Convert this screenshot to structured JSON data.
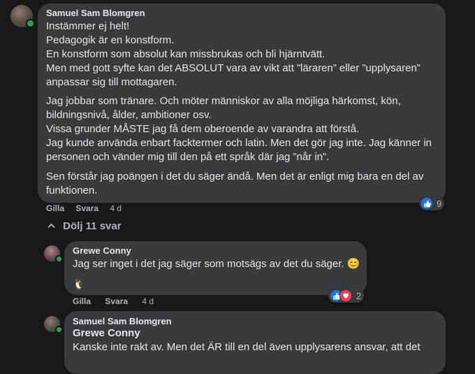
{
  "comments": [
    {
      "author": "Samuel Sam Blomgren",
      "paragraphs": [
        [
          "Instämmer ej helt!",
          "Pedagogik är en konstform.",
          "En konstform som absolut kan missbrukas och bli hjärntvätt.",
          "Men med gott syfte kan det ABSOLUT vara av vikt att ”läraren” eller ”upplysaren”",
          "anpassar sig till mottagaren."
        ],
        [
          "Jag jobbar som tränare. Och möter människor av alla möjliga härkomst, kön,",
          "bildningsnivå, ålder, ambitioner osv.",
          "Vissa grunder MÅSTE jag få dem oberoende av varandra att förstå.",
          "Jag kunde använda enbart facktermer och latin. Men det gör jag inte. Jag känner in",
          "personen och vänder mig till den på ett språk där jag ”når in”."
        ],
        [
          "Sen förstår jag poängen i det du säger ändå. Men det är enligt mig bara en del av",
          "funktionen."
        ]
      ],
      "actions": {
        "like": "Gilla",
        "reply": "Svara",
        "time": "4 d"
      },
      "reactions": {
        "count": "9"
      }
    },
    {
      "author": "Grewe Conny",
      "text": "Jag ser inget i det jag säger som motsägs av det du säger. 😊",
      "emoji": "🐧",
      "actions": {
        "like": "Gilla",
        "reply": "Svara",
        "time": "4 d"
      },
      "reactions": {
        "count": "2"
      }
    },
    {
      "author": "Samuel Sam Blomgren",
      "mention": "Grewe Conny",
      "text_lines": [
        "Kanske inte rakt av. Men det ÄR till en del även upplysarens ansvar, att det"
      ]
    }
  ],
  "hide_replies": "Dölj 11 svar",
  "colors": {
    "background": "#18191a",
    "bubble": "#3a3b3c",
    "like": "#1877f2",
    "love": "#f33e58",
    "online": "#31a24c"
  }
}
